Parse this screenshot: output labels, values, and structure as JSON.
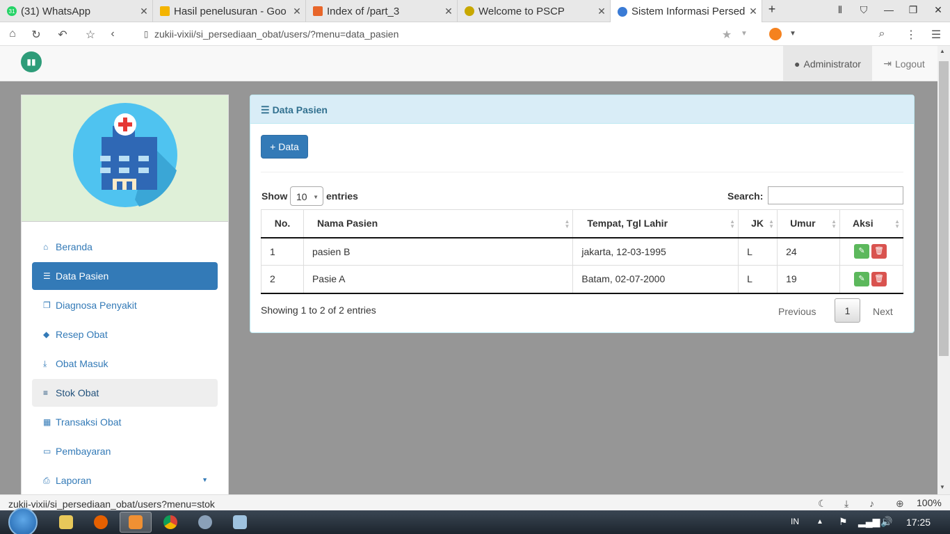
{
  "browser": {
    "tabs": [
      {
        "title": "(31) WhatsApp",
        "icon": "whatsapp-icon",
        "color": "#25d366"
      },
      {
        "title": "Hasil penelusuran - Goo",
        "icon": "google-drive-icon",
        "color": "#f4b400"
      },
      {
        "title": "Index of /part_3",
        "icon": "xampp-icon",
        "color": "#e8662a"
      },
      {
        "title": "Welcome to PSCP",
        "icon": "pscp-icon",
        "color": "#c8a800"
      },
      {
        "title": "Sistem Informasi Persed",
        "icon": "site-icon",
        "color": "#3a7bd5"
      }
    ],
    "address": "zukii-vixii/si_persediaan_obat/users/?menu=data_pasien",
    "status_url": "zukii-vixii/si_persediaan_obat/users?menu=stok",
    "zoom": "100%"
  },
  "header": {
    "admin_label": "Administrator",
    "logout_label": "Logout"
  },
  "sidebar": {
    "items": [
      {
        "label": "Beranda",
        "icon": "home-icon",
        "glyph": "⌂"
      },
      {
        "label": "Data Pasien",
        "icon": "database-icon",
        "glyph": "☰"
      },
      {
        "label": "Diagnosa Penyakit",
        "icon": "files-icon",
        "glyph": "❐"
      },
      {
        "label": "Resep Obat",
        "icon": "tags-icon",
        "glyph": "◆"
      },
      {
        "label": "Obat Masuk",
        "icon": "download-icon",
        "glyph": "⤓"
      },
      {
        "label": "Stok Obat",
        "icon": "tasks-icon",
        "glyph": "≡"
      },
      {
        "label": "Transaksi Obat",
        "icon": "table-icon",
        "glyph": "▦"
      },
      {
        "label": "Pembayaran",
        "icon": "credit-card-icon",
        "glyph": "▭"
      },
      {
        "label": "Laporan",
        "icon": "print-icon",
        "glyph": "⎙"
      }
    ]
  },
  "panel": {
    "title": "Data Pasien",
    "add_label": "+ Data",
    "show_label": "Show",
    "page_length": "10",
    "entries_label": "entries",
    "search_label": "Search:",
    "columns": [
      "No.",
      "Nama Pasien",
      "Tempat, Tgl Lahir",
      "JK",
      "Umur",
      "Aksi"
    ],
    "rows": [
      [
        "1",
        "pasien B",
        "jakarta, 12-03-1995",
        "L",
        "24"
      ],
      [
        "2",
        "Pasie A",
        "Batam, 02-07-2000",
        "L",
        "19"
      ]
    ],
    "info": "Showing 1 to 2 of 2 entries",
    "previous": "Previous",
    "page": "1",
    "next": "Next"
  },
  "taskbar": {
    "language": "IN",
    "time": "17:25"
  },
  "colors": {
    "primary": "#337ab7",
    "success": "#5cb85c",
    "danger": "#d9534f",
    "panel_heading": "#d9edf7"
  }
}
